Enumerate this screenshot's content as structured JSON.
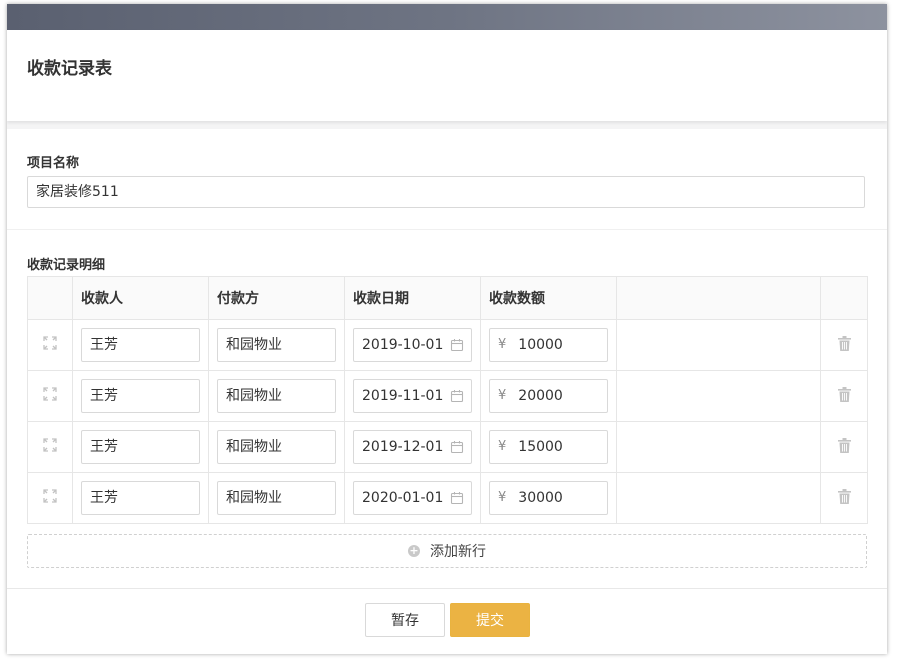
{
  "page": {
    "title": "收款记录表"
  },
  "project": {
    "label": "项目名称",
    "value": "家居装修511"
  },
  "records": {
    "label": "收款记录明细",
    "columns": [
      "收款人",
      "付款方",
      "收款日期",
      "收款数额"
    ],
    "currency_symbol": "¥",
    "rows": [
      {
        "payee": "王芳",
        "payer": "和园物业",
        "date": "2019-10-01",
        "amount": "10000"
      },
      {
        "payee": "王芳",
        "payer": "和园物业",
        "date": "2019-11-01",
        "amount": "20000"
      },
      {
        "payee": "王芳",
        "payer": "和园物业",
        "date": "2019-12-01",
        "amount": "15000"
      },
      {
        "payee": "王芳",
        "payer": "和园物业",
        "date": "2020-01-01",
        "amount": "30000"
      }
    ],
    "add_row_label": "添加新行"
  },
  "footer": {
    "save_label": "暂存",
    "submit_label": "提交"
  },
  "colors": {
    "accent": "#ebb343",
    "border": "#d9d9d9",
    "topbar": "#6e7483"
  },
  "icons": {
    "row_handle": "expand-icon",
    "row_delete": "trash-icon",
    "date": "calendar-icon",
    "add": "plus-circle-icon"
  }
}
